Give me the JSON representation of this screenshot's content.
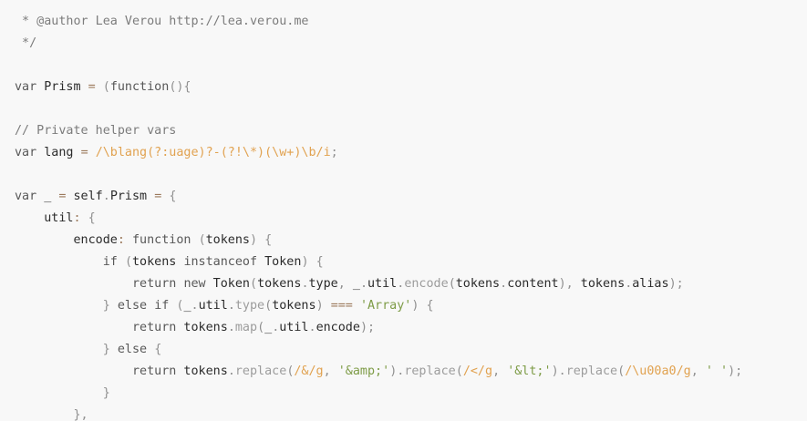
{
  "colors": {
    "background": "#f8f8f8",
    "comment": "#7c7c7c",
    "keyword": "#585858",
    "punctuation": "#909090",
    "operator": "#9c7a5c",
    "regex": "#e1a250",
    "string": "#7e9c47",
    "function": "#9c9c9c",
    "plain": "#2b2b2b"
  },
  "lines": [
    [
      {
        "t": "comment",
        "v": " * @author Lea Verou http://lea.verou.me"
      }
    ],
    [
      {
        "t": "comment",
        "v": " */"
      }
    ],
    [],
    [
      {
        "t": "keyword",
        "v": "var"
      },
      {
        "t": "plain",
        "v": " Prism "
      },
      {
        "t": "operator",
        "v": "="
      },
      {
        "t": "plain",
        "v": " "
      },
      {
        "t": "punct",
        "v": "("
      },
      {
        "t": "keyword",
        "v": "function"
      },
      {
        "t": "punct",
        "v": "(){"
      }
    ],
    [],
    [
      {
        "t": "comment",
        "v": "// Private helper vars"
      }
    ],
    [
      {
        "t": "keyword",
        "v": "var"
      },
      {
        "t": "plain",
        "v": " lang "
      },
      {
        "t": "operator",
        "v": "="
      },
      {
        "t": "plain",
        "v": " "
      },
      {
        "t": "regex",
        "v": "/\\blang(?:uage)?-(?!\\*)(\\w+)\\b/i"
      },
      {
        "t": "punct",
        "v": ";"
      }
    ],
    [],
    [
      {
        "t": "keyword",
        "v": "var"
      },
      {
        "t": "plain",
        "v": " _ "
      },
      {
        "t": "operator",
        "v": "="
      },
      {
        "t": "plain",
        "v": " self"
      },
      {
        "t": "punct",
        "v": "."
      },
      {
        "t": "plain",
        "v": "Prism "
      },
      {
        "t": "operator",
        "v": "="
      },
      {
        "t": "plain",
        "v": " "
      },
      {
        "t": "punct",
        "v": "{"
      }
    ],
    [
      {
        "t": "plain",
        "v": "    util"
      },
      {
        "t": "operator",
        "v": ":"
      },
      {
        "t": "plain",
        "v": " "
      },
      {
        "t": "punct",
        "v": "{"
      }
    ],
    [
      {
        "t": "plain",
        "v": "        encode"
      },
      {
        "t": "operator",
        "v": ":"
      },
      {
        "t": "plain",
        "v": " "
      },
      {
        "t": "keyword",
        "v": "function"
      },
      {
        "t": "plain",
        "v": " "
      },
      {
        "t": "punct",
        "v": "("
      },
      {
        "t": "plain",
        "v": "tokens"
      },
      {
        "t": "punct",
        "v": ")"
      },
      {
        "t": "plain",
        "v": " "
      },
      {
        "t": "punct",
        "v": "{"
      }
    ],
    [
      {
        "t": "plain",
        "v": "            "
      },
      {
        "t": "keyword",
        "v": "if"
      },
      {
        "t": "plain",
        "v": " "
      },
      {
        "t": "punct",
        "v": "("
      },
      {
        "t": "plain",
        "v": "tokens "
      },
      {
        "t": "keyword",
        "v": "instanceof"
      },
      {
        "t": "plain",
        "v": " Token"
      },
      {
        "t": "punct",
        "v": ")"
      },
      {
        "t": "plain",
        "v": " "
      },
      {
        "t": "punct",
        "v": "{"
      }
    ],
    [
      {
        "t": "plain",
        "v": "                "
      },
      {
        "t": "keyword",
        "v": "return"
      },
      {
        "t": "plain",
        "v": " "
      },
      {
        "t": "keyword",
        "v": "new"
      },
      {
        "t": "plain",
        "v": " Token"
      },
      {
        "t": "punct",
        "v": "("
      },
      {
        "t": "plain",
        "v": "tokens"
      },
      {
        "t": "punct",
        "v": "."
      },
      {
        "t": "plain",
        "v": "type"
      },
      {
        "t": "punct",
        "v": ","
      },
      {
        "t": "plain",
        "v": " _"
      },
      {
        "t": "punct",
        "v": "."
      },
      {
        "t": "plain",
        "v": "util"
      },
      {
        "t": "punct",
        "v": "."
      },
      {
        "t": "function",
        "v": "encode"
      },
      {
        "t": "punct",
        "v": "("
      },
      {
        "t": "plain",
        "v": "tokens"
      },
      {
        "t": "punct",
        "v": "."
      },
      {
        "t": "plain",
        "v": "content"
      },
      {
        "t": "punct",
        "v": "),"
      },
      {
        "t": "plain",
        "v": " tokens"
      },
      {
        "t": "punct",
        "v": "."
      },
      {
        "t": "plain",
        "v": "alias"
      },
      {
        "t": "punct",
        "v": ");"
      }
    ],
    [
      {
        "t": "plain",
        "v": "            "
      },
      {
        "t": "punct",
        "v": "}"
      },
      {
        "t": "plain",
        "v": " "
      },
      {
        "t": "keyword",
        "v": "else"
      },
      {
        "t": "plain",
        "v": " "
      },
      {
        "t": "keyword",
        "v": "if"
      },
      {
        "t": "plain",
        "v": " "
      },
      {
        "t": "punct",
        "v": "("
      },
      {
        "t": "plain",
        "v": "_"
      },
      {
        "t": "punct",
        "v": "."
      },
      {
        "t": "plain",
        "v": "util"
      },
      {
        "t": "punct",
        "v": "."
      },
      {
        "t": "function",
        "v": "type"
      },
      {
        "t": "punct",
        "v": "("
      },
      {
        "t": "plain",
        "v": "tokens"
      },
      {
        "t": "punct",
        "v": ")"
      },
      {
        "t": "plain",
        "v": " "
      },
      {
        "t": "operator",
        "v": "==="
      },
      {
        "t": "plain",
        "v": " "
      },
      {
        "t": "string",
        "v": "'Array'"
      },
      {
        "t": "punct",
        "v": ")"
      },
      {
        "t": "plain",
        "v": " "
      },
      {
        "t": "punct",
        "v": "{"
      }
    ],
    [
      {
        "t": "plain",
        "v": "                "
      },
      {
        "t": "keyword",
        "v": "return"
      },
      {
        "t": "plain",
        "v": " tokens"
      },
      {
        "t": "punct",
        "v": "."
      },
      {
        "t": "function",
        "v": "map"
      },
      {
        "t": "punct",
        "v": "("
      },
      {
        "t": "plain",
        "v": "_"
      },
      {
        "t": "punct",
        "v": "."
      },
      {
        "t": "plain",
        "v": "util"
      },
      {
        "t": "punct",
        "v": "."
      },
      {
        "t": "plain",
        "v": "encode"
      },
      {
        "t": "punct",
        "v": ");"
      }
    ],
    [
      {
        "t": "plain",
        "v": "            "
      },
      {
        "t": "punct",
        "v": "}"
      },
      {
        "t": "plain",
        "v": " "
      },
      {
        "t": "keyword",
        "v": "else"
      },
      {
        "t": "plain",
        "v": " "
      },
      {
        "t": "punct",
        "v": "{"
      }
    ],
    [
      {
        "t": "plain",
        "v": "                "
      },
      {
        "t": "keyword",
        "v": "return"
      },
      {
        "t": "plain",
        "v": " tokens"
      },
      {
        "t": "punct",
        "v": "."
      },
      {
        "t": "function",
        "v": "replace"
      },
      {
        "t": "punct",
        "v": "("
      },
      {
        "t": "regex",
        "v": "/&/g"
      },
      {
        "t": "punct",
        "v": ","
      },
      {
        "t": "plain",
        "v": " "
      },
      {
        "t": "string",
        "v": "'&amp;'"
      },
      {
        "t": "punct",
        "v": ")."
      },
      {
        "t": "function",
        "v": "replace"
      },
      {
        "t": "punct",
        "v": "("
      },
      {
        "t": "regex",
        "v": "/</g"
      },
      {
        "t": "punct",
        "v": ","
      },
      {
        "t": "plain",
        "v": " "
      },
      {
        "t": "string",
        "v": "'&lt;'"
      },
      {
        "t": "punct",
        "v": ")."
      },
      {
        "t": "function",
        "v": "replace"
      },
      {
        "t": "punct",
        "v": "("
      },
      {
        "t": "regex",
        "v": "/\\u00a0/g"
      },
      {
        "t": "punct",
        "v": ","
      },
      {
        "t": "plain",
        "v": " "
      },
      {
        "t": "string",
        "v": "' '"
      },
      {
        "t": "punct",
        "v": ");"
      }
    ],
    [
      {
        "t": "plain",
        "v": "            "
      },
      {
        "t": "punct",
        "v": "}"
      }
    ],
    [
      {
        "t": "plain",
        "v": "        "
      },
      {
        "t": "punct",
        "v": "},"
      }
    ]
  ]
}
